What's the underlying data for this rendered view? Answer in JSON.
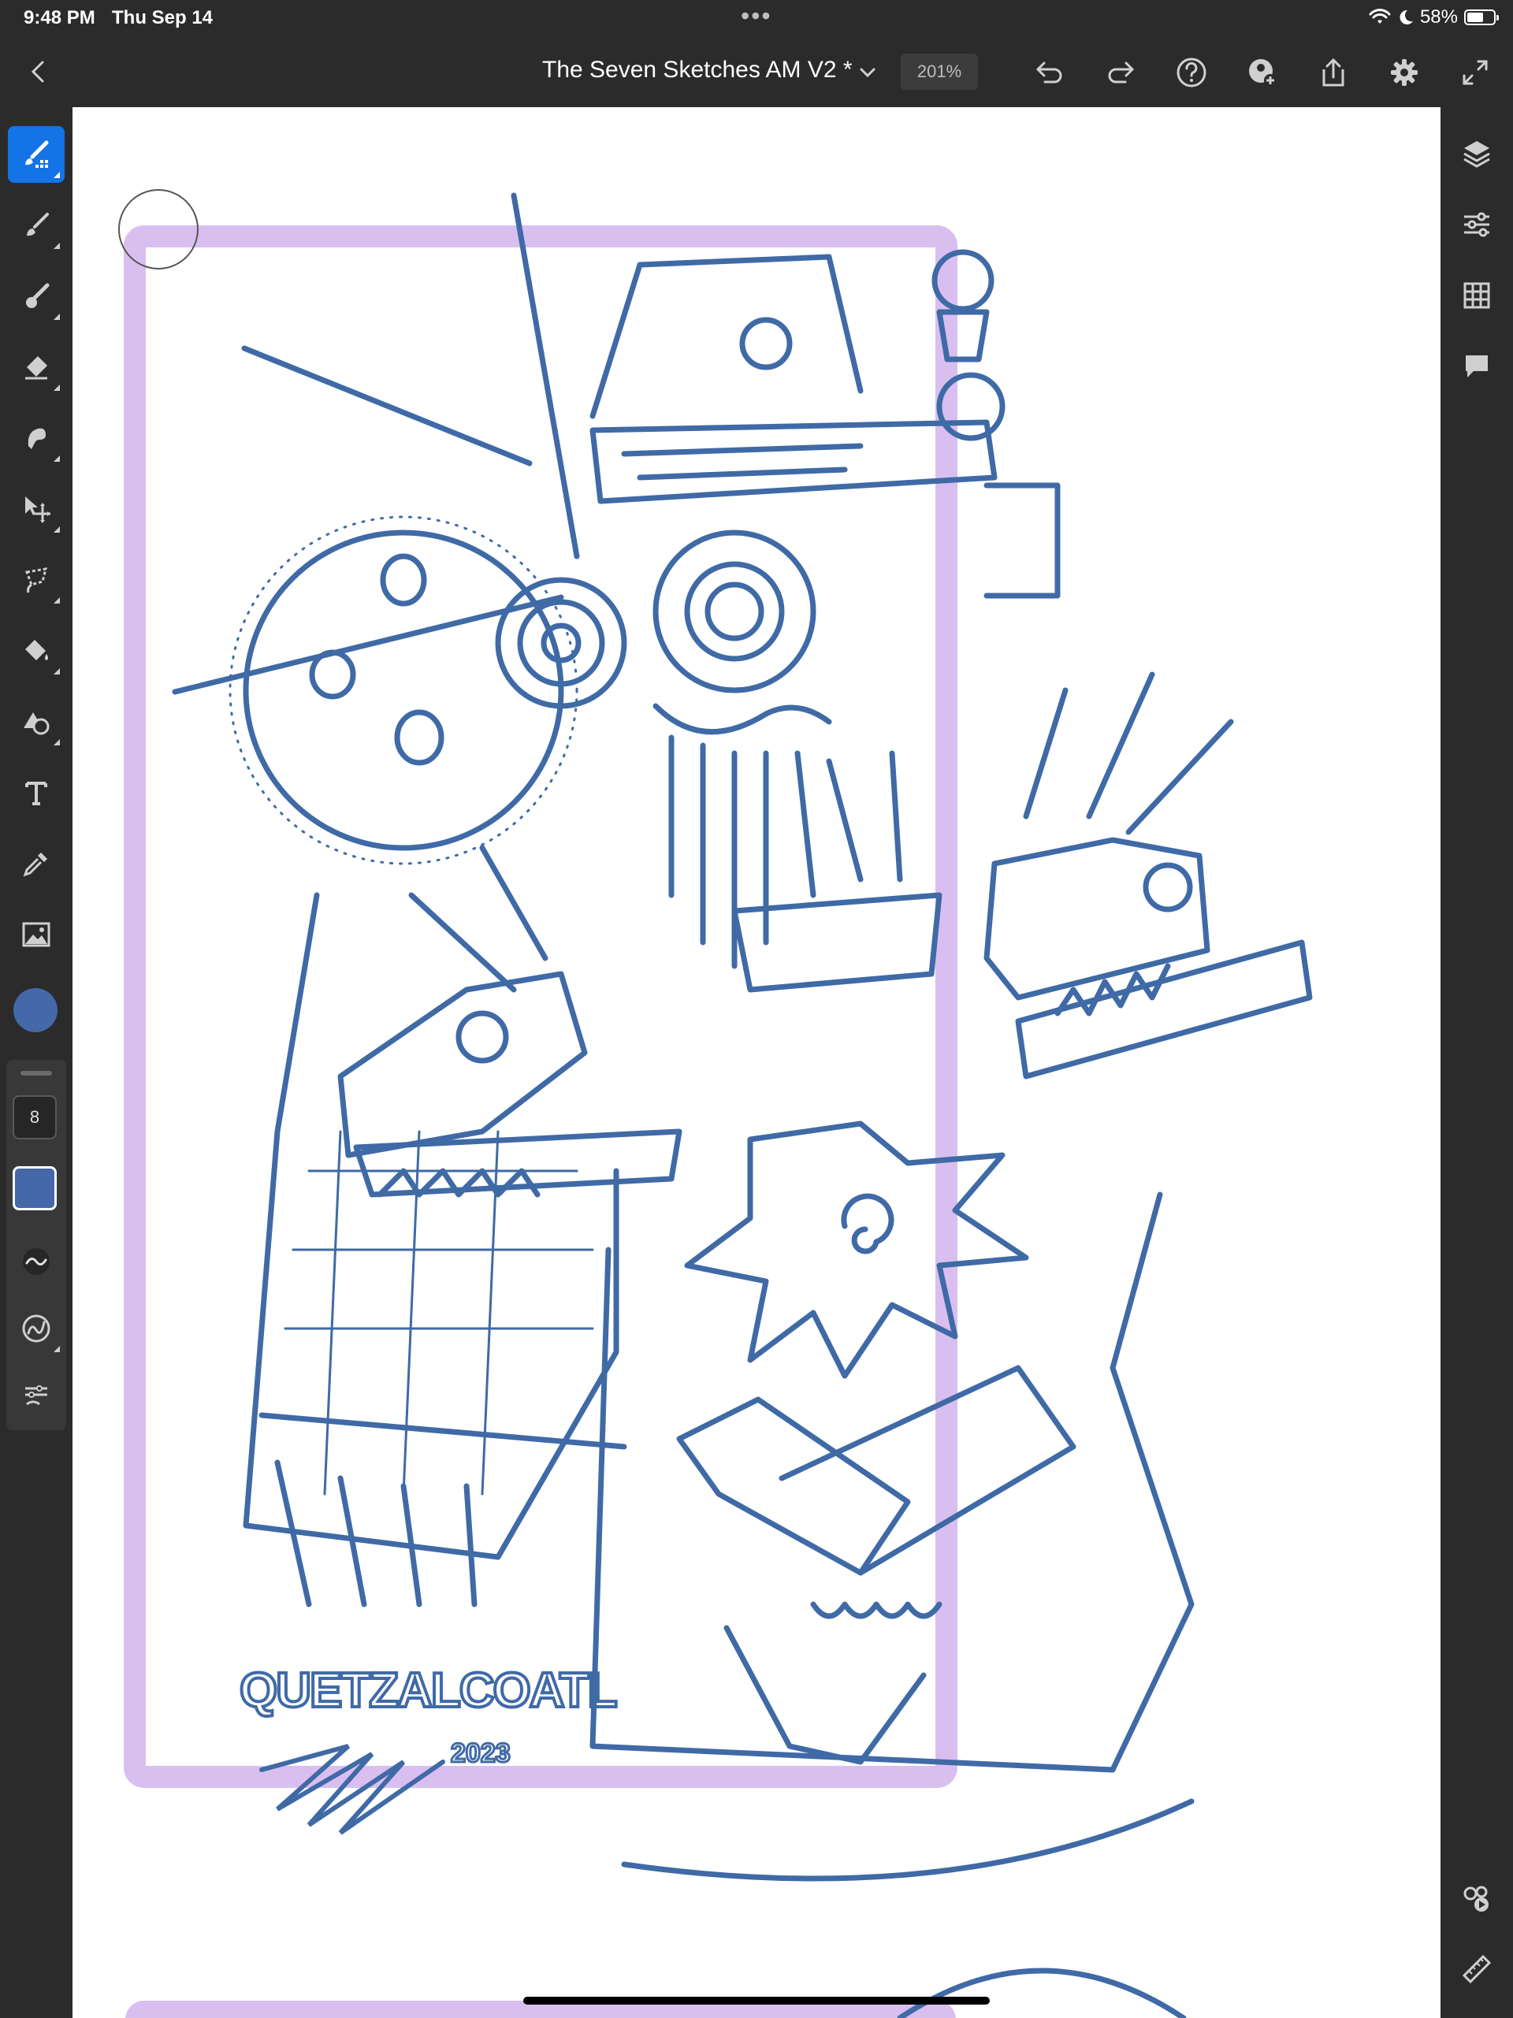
{
  "status": {
    "time": "9:48 PM",
    "date": "Thu Sep 14",
    "battery": "58%",
    "more": "•••"
  },
  "toolbar": {
    "title": "The Seven Sketches AM V2 *",
    "zoom": "201%"
  },
  "left_tools": [
    {
      "name": "paint-brush-tool",
      "active": true
    },
    {
      "name": "pixel-brush-tool"
    },
    {
      "name": "live-brush-tool"
    },
    {
      "name": "eraser-tool"
    },
    {
      "name": "smudge-tool"
    },
    {
      "name": "transform-tool"
    },
    {
      "name": "lasso-select-tool"
    },
    {
      "name": "fill-tool"
    },
    {
      "name": "shapes-tool"
    },
    {
      "name": "text-tool"
    },
    {
      "name": "eyedropper-tool"
    },
    {
      "name": "image-tool"
    }
  ],
  "brush": {
    "size": "8",
    "color": "#4468a8"
  },
  "canvas": {
    "border_color": "#d9bff0",
    "ink_color": "#3f6aa6",
    "signature_text": "QUETZALCOATL",
    "year_text": "2023"
  }
}
